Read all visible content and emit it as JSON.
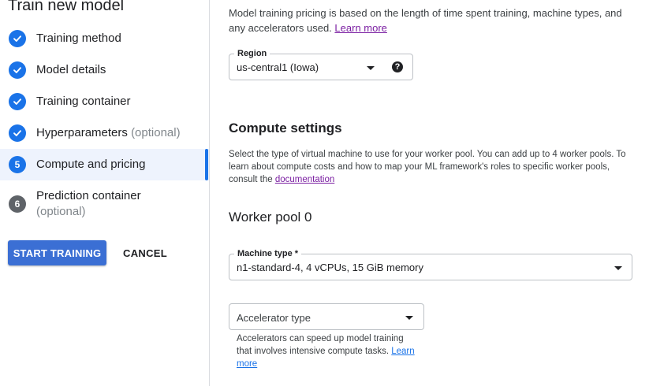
{
  "left": {
    "title": "Train new model",
    "steps": [
      {
        "label": "Training method",
        "optional": "",
        "state": "done"
      },
      {
        "label": "Model details",
        "optional": "",
        "state": "done"
      },
      {
        "label": "Training container",
        "optional": "",
        "state": "done"
      },
      {
        "label": "Hyperparameters",
        "optional": "(optional)",
        "state": "done"
      },
      {
        "label": "Compute and pricing",
        "optional": "",
        "state": "active",
        "number": "5"
      },
      {
        "label": "Prediction container",
        "optional": "(optional)",
        "state": "pending",
        "number": "6"
      }
    ],
    "start_button": "START TRAINING",
    "cancel_button": "CANCEL"
  },
  "pricing": {
    "text": "Model training pricing is based on the length of time spent training, machine types, and any accelerators used.",
    "link": "Learn more"
  },
  "region": {
    "label": "Region",
    "value": "us-central1 (Iowa)",
    "help_glyph": "?"
  },
  "compute": {
    "heading": "Compute settings",
    "description": "Select the type of virtual machine to use for your worker pool. You can add up to 4 worker pools. To learn about compute costs and how to map your ML framework's roles to specific worker pools, consult the",
    "doc_link": "documentation"
  },
  "worker_pool": {
    "heading": "Worker pool 0",
    "machine_type": {
      "label": "Machine type *",
      "value": "n1-standard-4, 4 vCPUs, 15 GiB memory"
    },
    "accelerator": {
      "placeholder": "Accelerator type",
      "help": "Accelerators can speed up model training that involves intensive compute tasks.",
      "link": "Learn more"
    }
  },
  "colors": {
    "accent": "#1a73e8",
    "primary_button": "#3b6fd4",
    "active_row": "#eef3fd",
    "visited_link": "#7b1fa2"
  },
  "icons": {
    "done": "check-circle-icon",
    "dropdown": "arrow-drop-down-icon",
    "help": "help-icon"
  }
}
